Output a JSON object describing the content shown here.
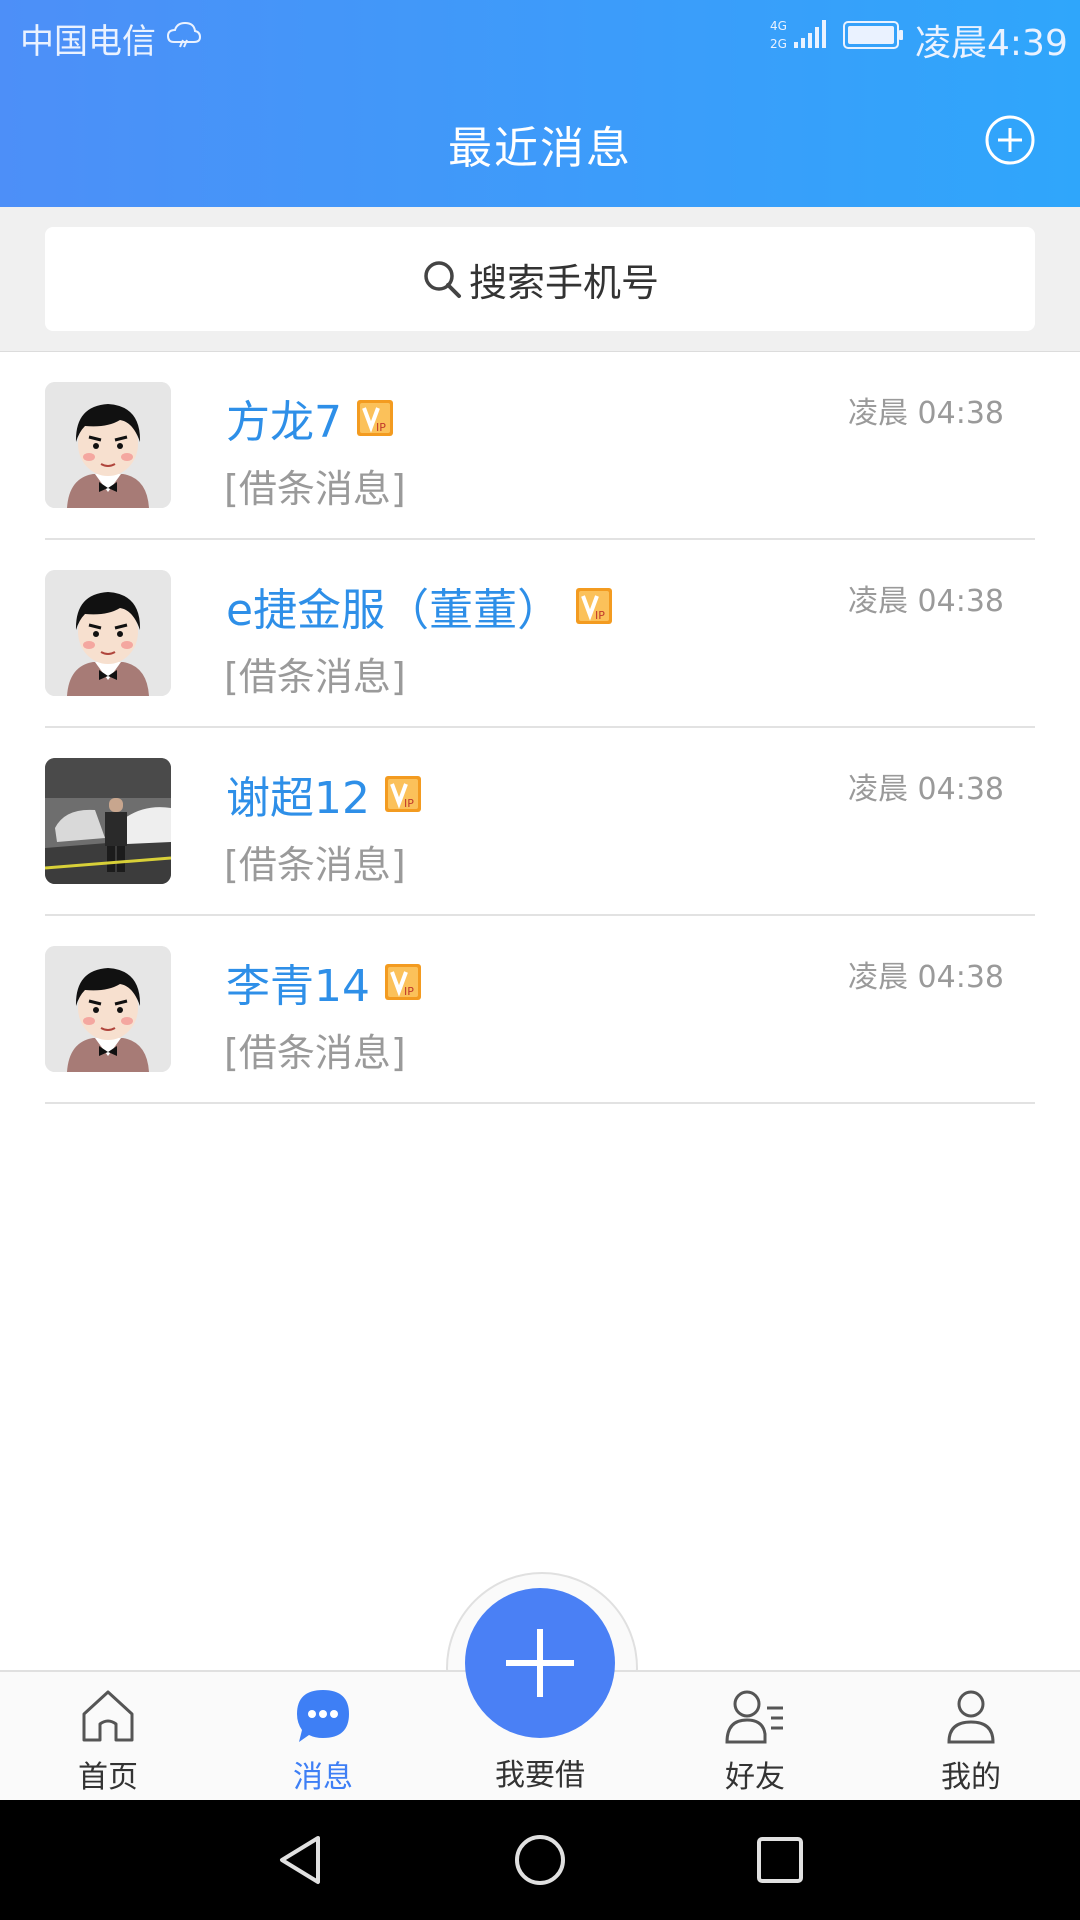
{
  "status_bar": {
    "carrier": "中国电信",
    "time": "凌晨4:39"
  },
  "header": {
    "title": "最近消息"
  },
  "search": {
    "placeholder": "搜索手机号"
  },
  "messages": [
    {
      "name": "方龙7",
      "preview": "[借条消息]",
      "time": "凌晨 04:38",
      "avatar": "cartoon"
    },
    {
      "name": "e捷金服（董董）",
      "preview": "[借条消息]",
      "time": "凌晨 04:38",
      "avatar": "cartoon"
    },
    {
      "name": "谢超12",
      "preview": "[借条消息]",
      "time": "凌晨 04:38",
      "avatar": "photo"
    },
    {
      "name": "李青14",
      "preview": "[借条消息]",
      "time": "凌晨 04:38",
      "avatar": "cartoon"
    }
  ],
  "bottom_nav": {
    "items": [
      {
        "label": "首页",
        "icon": "home-icon",
        "active": false
      },
      {
        "label": "消息",
        "icon": "chat-icon",
        "active": true
      },
      {
        "label": "我要借",
        "icon": "plus-icon",
        "active": false
      },
      {
        "label": "好友",
        "icon": "friends-icon",
        "active": false
      },
      {
        "label": "我的",
        "icon": "profile-icon",
        "active": false
      }
    ]
  },
  "colors": {
    "header_gradient_start": "#4d8ff8",
    "header_gradient_end": "#2fa6fb",
    "name_blue": "#2e8fe8",
    "active_nav": "#3e7ff5",
    "fab": "#4a80f5"
  }
}
